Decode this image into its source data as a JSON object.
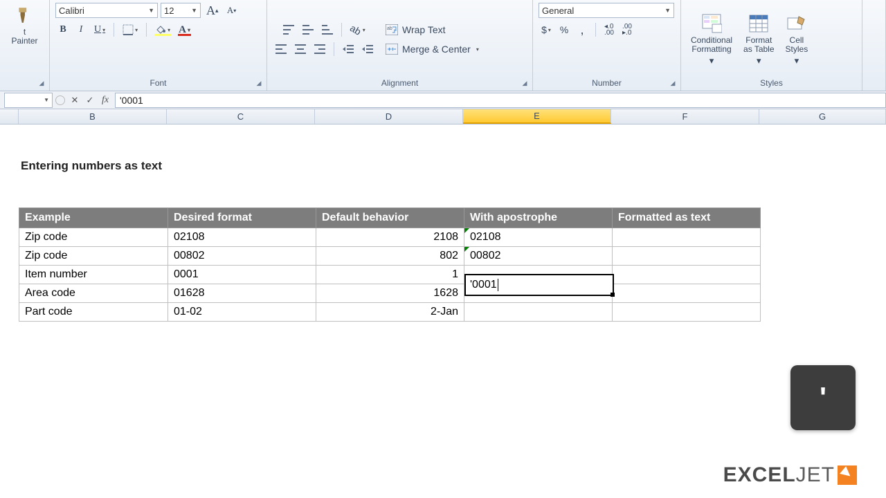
{
  "ribbon": {
    "clipboard": {
      "format_painter": "t Painter"
    },
    "font": {
      "label": "Font",
      "name": "Calibri",
      "size": "12",
      "bold": "B",
      "italic": "I",
      "underline": "U",
      "grow": "A",
      "shrink": "A"
    },
    "alignment": {
      "label": "Alignment",
      "wrap": "Wrap Text",
      "merge": "Merge & Center"
    },
    "number": {
      "label": "Number",
      "format": "General",
      "currency": "$",
      "percent": "%",
      "comma": ",",
      "inc_dec": ".0",
      "dec_dec": ".00"
    },
    "styles": {
      "label": "Styles",
      "conditional": "Conditional\nFormatting",
      "format_table": "Format\nas Table",
      "cell_styles": "Cell\nStyles"
    }
  },
  "formula_bar": {
    "value": "'0001"
  },
  "columns": [
    "B",
    "C",
    "D",
    "E",
    "F",
    "G"
  ],
  "active_column": "E",
  "sheet": {
    "title": "Entering numbers as text",
    "headers": [
      "Example",
      "Desired format",
      "Default behavior",
      "With apostrophe",
      "Formatted as text"
    ],
    "rows": [
      {
        "example": "Zip code",
        "desired": "02108",
        "default": "2108",
        "apos": "02108",
        "ft": ""
      },
      {
        "example": "Zip code",
        "desired": "00802",
        "default": "802",
        "apos": "00802",
        "ft": ""
      },
      {
        "example": "Item number",
        "desired": "0001",
        "default": "1",
        "apos": "'0001",
        "ft": ""
      },
      {
        "example": "Area code",
        "desired": "01628",
        "default": "1628",
        "apos": "",
        "ft": ""
      },
      {
        "example": "Part code",
        "desired": "01-02",
        "default": "2-Jan",
        "apos": "",
        "ft": ""
      }
    ],
    "active_cell_value": "'0001"
  },
  "branding": {
    "logo1": "EXCEL",
    "logo2": "JET"
  },
  "key_overlay": "'"
}
